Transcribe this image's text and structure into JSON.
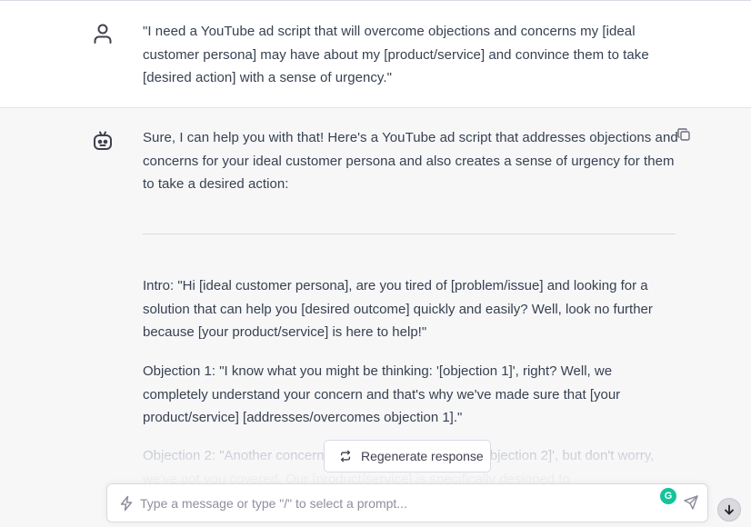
{
  "conversation": {
    "user_message": "\"I need a YouTube ad script that will overcome objections and concerns my [ideal customer persona] may have about my [product/service] and convince them to take [desired action] with a sense of urgency.\"",
    "assistant_intro": "Sure, I can help you with that! Here's a YouTube ad script that addresses objections and concerns for your ideal customer persona and also creates a sense of urgency for them to take a desired action:",
    "script_paragraphs": [
      "Intro: \"Hi [ideal customer persona], are you tired of [problem/issue] and looking for a solution that can help you [desired outcome] quickly and easily? Well, look no further because [your product/service] is here to help!\"",
      "Objection 1: \"I know what you might be thinking: '[objection 1]', right? Well, we completely understand your concern and that's why we've made sure that [your product/service] [addresses/overcomes objection 1].\"",
      "Objection 2: \"Another concern you might have is about '[objection 2]', but don't worry, we've got you covered. Our [product/service] is specifically designed to"
    ]
  },
  "actions": {
    "regenerate_label": "Regenerate response"
  },
  "composer": {
    "placeholder": "Type a message or type \"/\" to select a prompt...",
    "grammarly_letter": "G"
  },
  "icons": {
    "user_avatar": "user-icon",
    "bot_avatar": "robot-icon",
    "copy": "copy-icon",
    "regenerate": "refresh-icon",
    "prompt": "lightning-icon",
    "grammarly": "grammarly-icon",
    "send": "send-icon",
    "scroll": "arrow-down-icon"
  },
  "colors": {
    "user_bg": "#ffffff",
    "assistant_bg": "#f7f7f8",
    "text": "#374151",
    "grammarly": "#15c39a"
  }
}
